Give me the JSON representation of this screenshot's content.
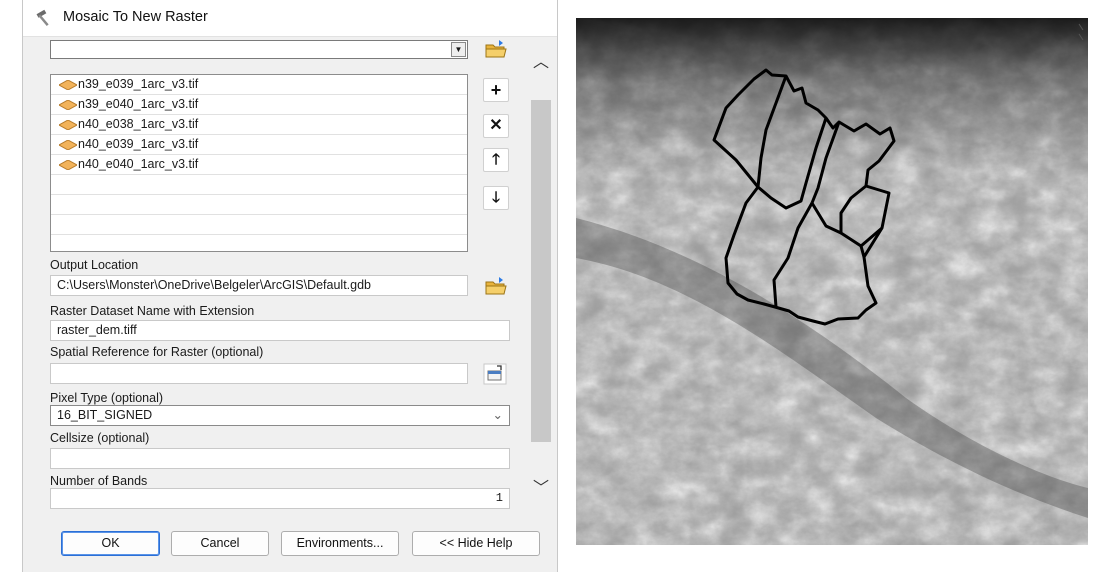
{
  "dialog": {
    "title": "Mosaic To New Raster",
    "input_combo_value": "",
    "input_rasters": [
      "n39_e039_1arc_v3.tif",
      "n39_e040_1arc_v3.tif",
      "n40_e038_1arc_v3.tif",
      "n40_e039_1arc_v3.tif",
      "n40_e040_1arc_v3.tif"
    ],
    "list_side_buttons": [
      "add-icon",
      "remove-icon",
      "move-up-icon",
      "move-down-icon"
    ],
    "output_location": {
      "label": "Output Location",
      "value": "C:\\Users\\Monster\\OneDrive\\Belgeler\\ArcGIS\\Default.gdb"
    },
    "raster_name": {
      "label": "Raster Dataset Name with Extension",
      "value": "raster_dem.tiff"
    },
    "spatial_reference": {
      "label": "Spatial Reference for Raster (optional)",
      "value": ""
    },
    "pixel_type": {
      "label": "Pixel Type (optional)",
      "value": "16_BIT_SIGNED"
    },
    "cellsize": {
      "label": "Cellsize (optional)",
      "value": ""
    },
    "number_of_bands": {
      "label": "Number of Bands",
      "value": "1"
    },
    "buttons": {
      "ok": "OK",
      "cancel": "Cancel",
      "environments": "Environments...",
      "hide_help": "<< Hide Help"
    }
  },
  "map": {
    "description": "",
    "colors": {
      "boundary": "#000000",
      "low": "#3a3a3a",
      "high": "#f4f4f4"
    }
  }
}
